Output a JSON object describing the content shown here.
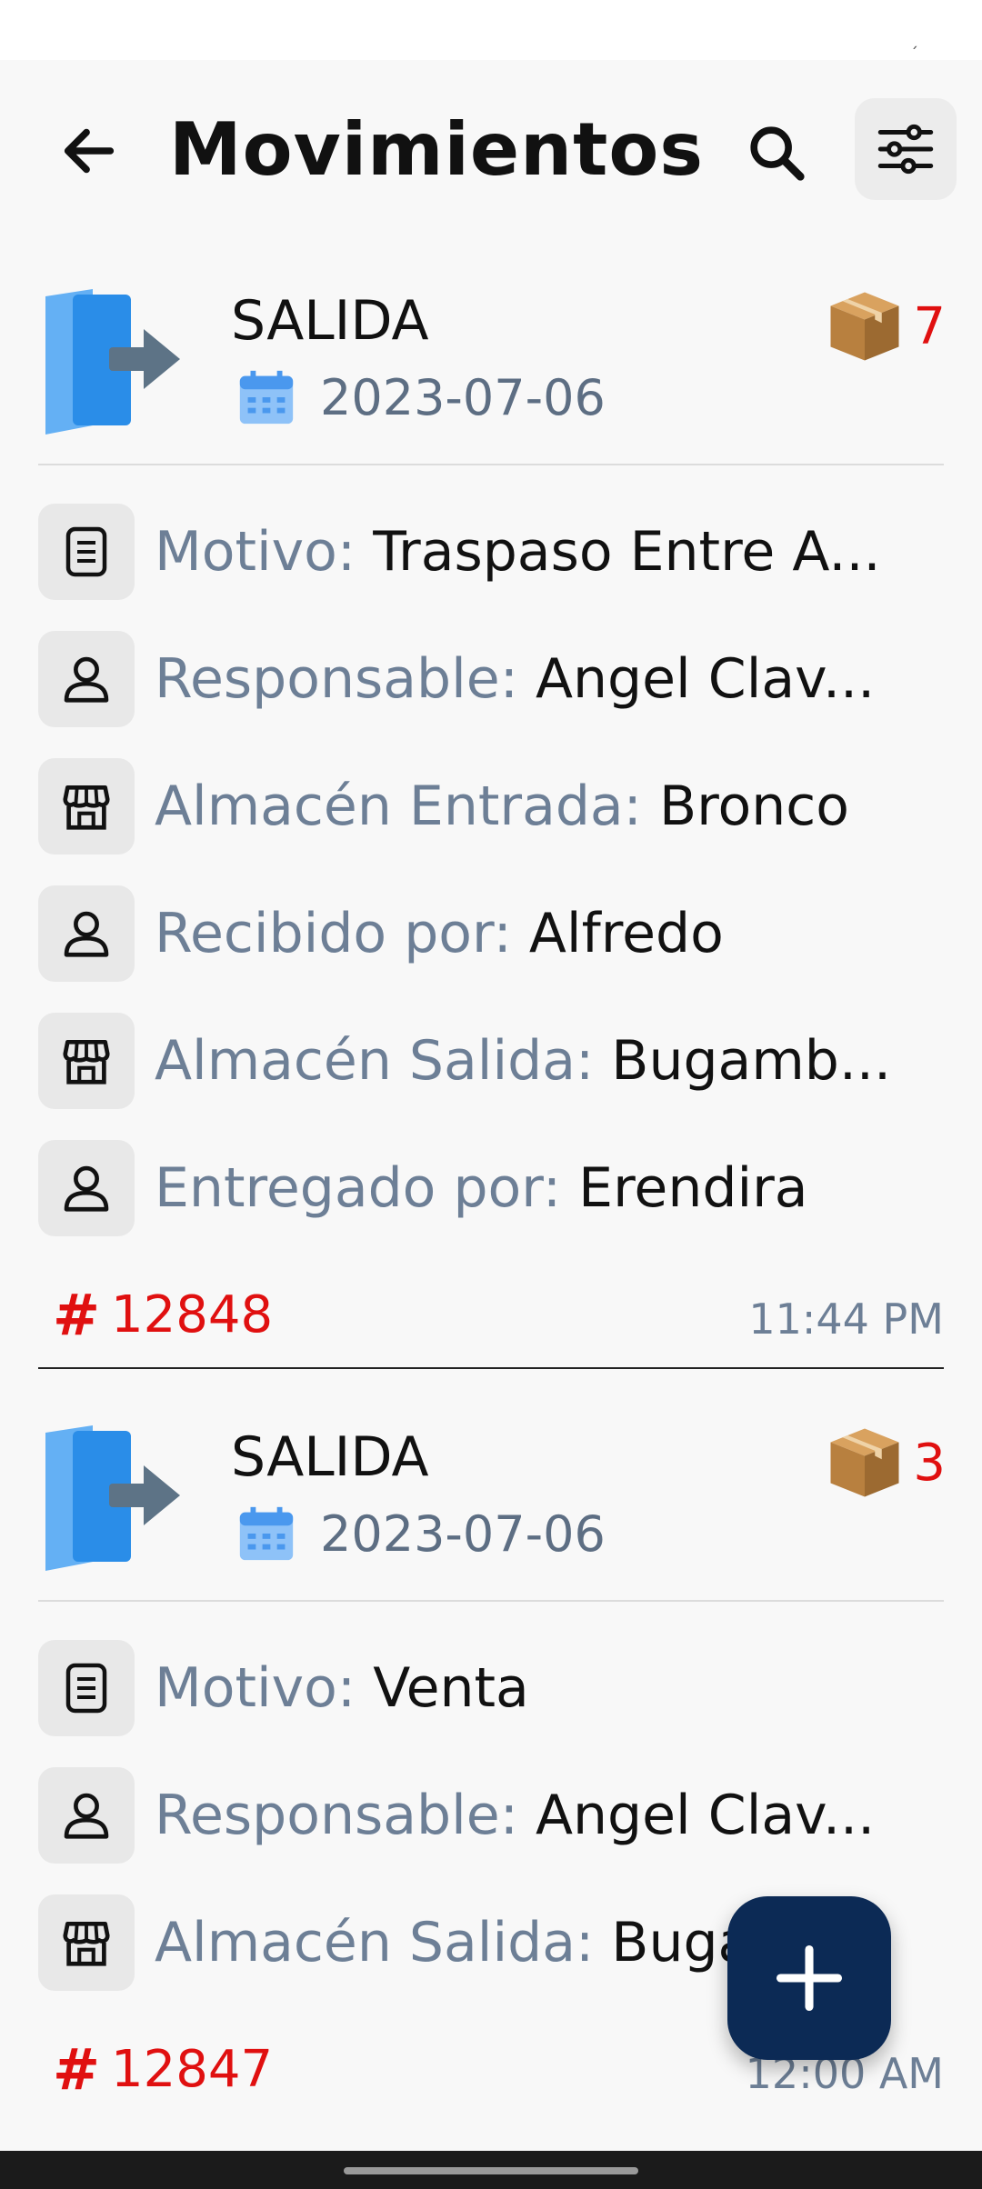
{
  "header": {
    "title": "Movimientos",
    "back_icon": "arrow-left-icon",
    "search_icon": "search-icon",
    "filter_icon": "sliders-icon"
  },
  "cards": [
    {
      "type": "SALIDA",
      "date": "2023-07-06",
      "quantity": "7",
      "rows": [
        {
          "icon": "document-icon",
          "label": "Motivo:",
          "value": "Traspaso Entre A..."
        },
        {
          "icon": "person-icon",
          "label": "Responsable:",
          "value": "Angel Clav..."
        },
        {
          "icon": "store-icon",
          "label": "Almacén Entrada:",
          "value": "Bronco"
        },
        {
          "icon": "person-icon",
          "label": "Recibido por:",
          "value": "Alfredo"
        },
        {
          "icon": "store-icon",
          "label": "Almacén Salida:",
          "value": "Bugamb..."
        },
        {
          "icon": "person-icon",
          "label": "Entregado por:",
          "value": "Erendira"
        }
      ],
      "ref_hash": "#",
      "ref": "12848",
      "time": "11:44 PM"
    },
    {
      "type": "SALIDA",
      "date": "2023-07-06",
      "quantity": "3",
      "rows": [
        {
          "icon": "document-icon",
          "label": "Motivo:",
          "value": "Venta"
        },
        {
          "icon": "person-icon",
          "label": "Responsable:",
          "value": "Angel Clav..."
        },
        {
          "icon": "store-icon",
          "label": "Almacén Salida:",
          "value": "Bugamb..."
        }
      ],
      "ref_hash": "#",
      "ref": "12847",
      "time": "12:00 AM"
    }
  ],
  "fab": {
    "icon": "plus-icon"
  },
  "colors": {
    "accent_red": "#e01010",
    "label_gray": "#6d7f96",
    "fab_navy": "#0c2a55"
  }
}
